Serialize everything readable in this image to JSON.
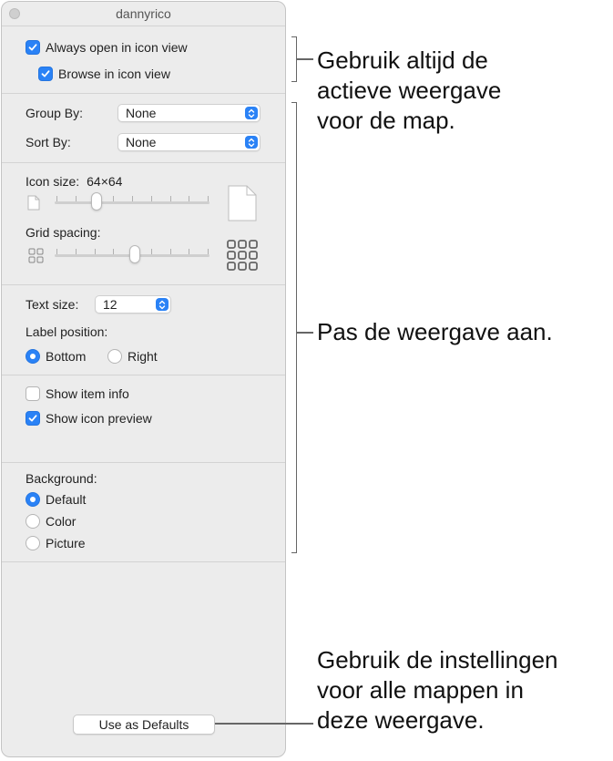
{
  "window": {
    "title": "dannyrico"
  },
  "view_options": {
    "always_open_icon_view": {
      "label": "Always open in icon view",
      "checked": true
    },
    "browse_icon_view": {
      "label": "Browse in icon view",
      "checked": true
    }
  },
  "arrange": {
    "group_by_label": "Group By:",
    "group_by_value": "None",
    "sort_by_label": "Sort By:",
    "sort_by_value": "None"
  },
  "icons": {
    "icon_size_label": "Icon size:",
    "icon_size_value": "64×64",
    "icon_size_slider": 0.25,
    "grid_spacing_label": "Grid spacing:",
    "grid_spacing_slider": 0.52
  },
  "text": {
    "text_size_label": "Text size:",
    "text_size_value": "12",
    "label_position_label": "Label position:",
    "bottom_label": "Bottom",
    "right_label": "Right",
    "selected": "Bottom"
  },
  "info": {
    "show_item_info": {
      "label": "Show item info",
      "checked": false
    },
    "show_icon_preview": {
      "label": "Show icon preview",
      "checked": true
    }
  },
  "background": {
    "label": "Background:",
    "options": [
      "Default",
      "Color",
      "Picture"
    ],
    "selected": "Default"
  },
  "defaults_button": "Use as Defaults",
  "callouts": {
    "top": "Gebruik altijd de\nactieve weergave\nvoor de map.",
    "middle": "Pas de weergave aan.",
    "bottom": "Gebruik de instellingen\nvoor alle mappen in\ndeze weergave."
  },
  "colors": {
    "accent": "#2a82f6",
    "window_bg": "#ececec"
  }
}
